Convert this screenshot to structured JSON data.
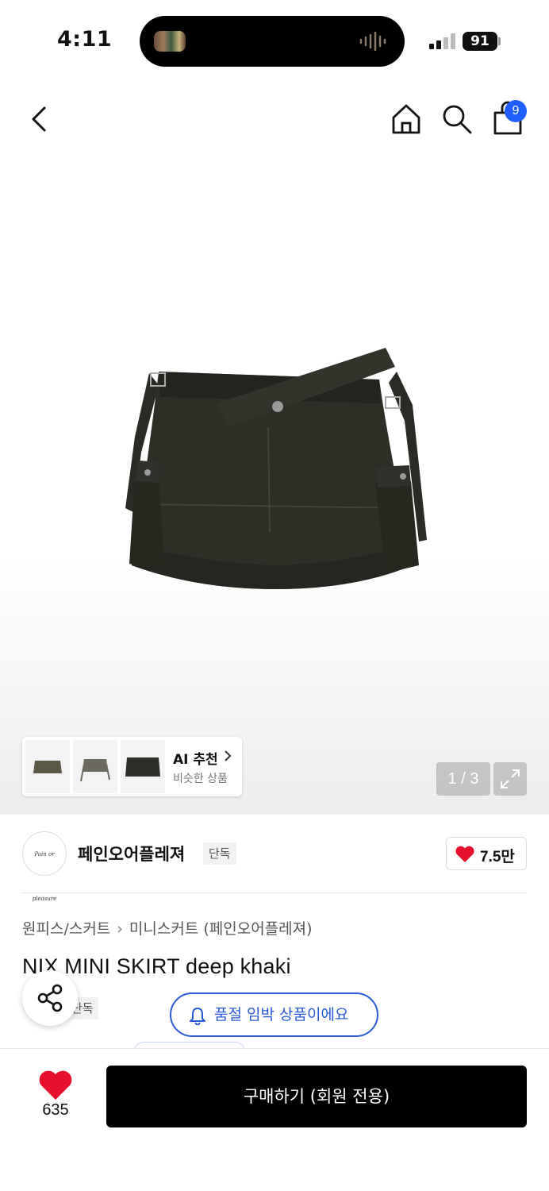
{
  "status_bar": {
    "time": "4:11",
    "battery": "91"
  },
  "header": {
    "cart_count": "9"
  },
  "gallery": {
    "ai_title": "AI 추천",
    "ai_subtitle": "비슷한 상품",
    "pager": "1 / 3"
  },
  "brand": {
    "name": "페인오어플레져",
    "tag": "단독",
    "logo_text": "Pain or pleasure",
    "likes": "7.5만"
  },
  "product": {
    "breadcrumb": [
      "원피스/스커트",
      "미니스커트 (페인오어플레져)"
    ],
    "title": "NIX MINI SKIRT deep khaki",
    "tag": "단독"
  },
  "soldout_notice": "품절 임박 상품이에요",
  "bottom_bar": {
    "wish_count": "635",
    "buy_label": "구매하기 (회원 전용)"
  },
  "colors": {
    "accent": "#2a5bd7",
    "heart": "#e8112d",
    "badge": "#1f5eff"
  }
}
